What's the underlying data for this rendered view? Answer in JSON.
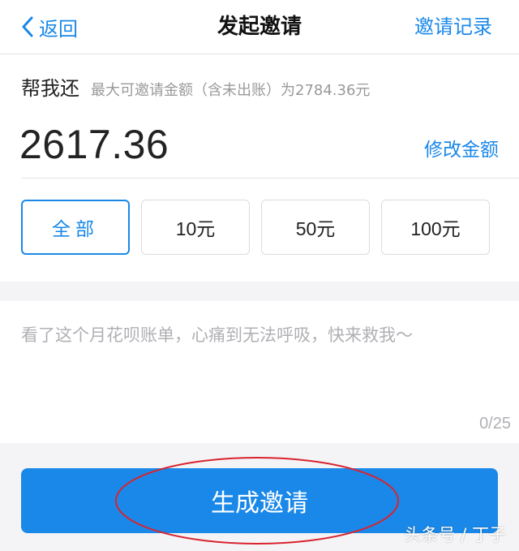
{
  "nav": {
    "back_label": "返回",
    "title": "发起邀请",
    "right_label": "邀请记录",
    "accent": "#1a88e8"
  },
  "card": {
    "title": "帮我还",
    "subtitle": "最大可邀请金额（含未出账）为2784.36元",
    "amount": "2617.36",
    "edit_label": "修改金额",
    "options": [
      {
        "label": "全部",
        "selected": true
      },
      {
        "label": "10元",
        "selected": false
      },
      {
        "label": "50元",
        "selected": false
      },
      {
        "label": "100元",
        "selected": false
      }
    ]
  },
  "message": {
    "placeholder": "看了这个月花呗账单，心痛到无法呼吸，快来救我～",
    "counter": "0/25"
  },
  "actions": {
    "generate_label": "生成邀请",
    "annotation_color": "#d9232e"
  },
  "watermark": {
    "text": "头条号 / 丁子"
  },
  "icons": {
    "back": "chevron-left-icon"
  }
}
